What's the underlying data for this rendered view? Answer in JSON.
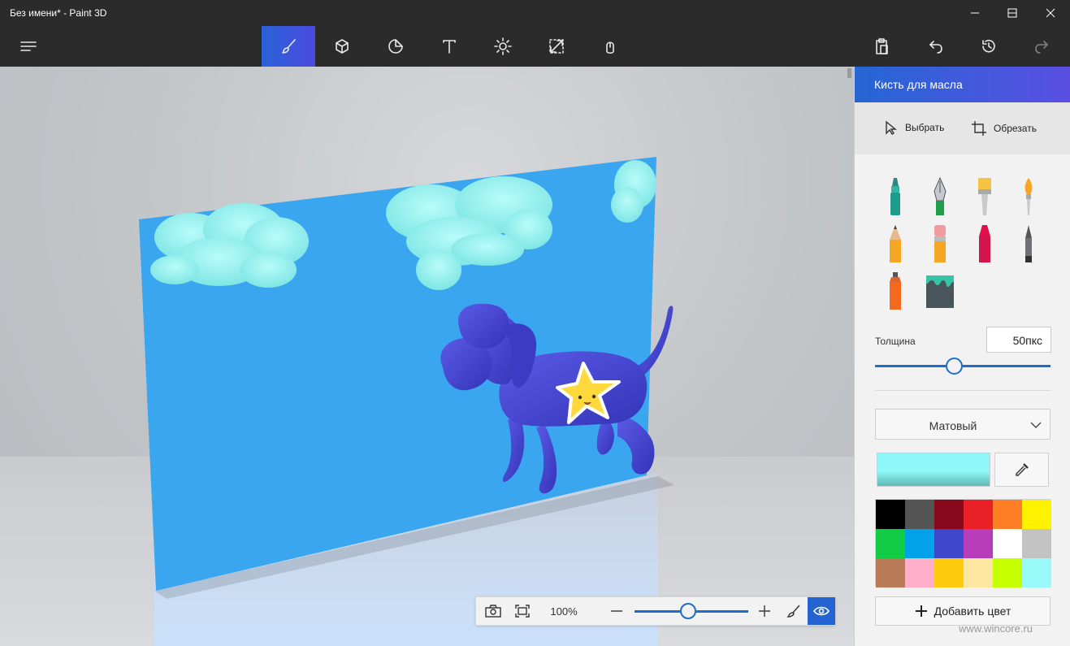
{
  "window": {
    "title": "Без имени* - Paint 3D"
  },
  "toolbar": {
    "tools": [
      {
        "name": "brushes",
        "active": true
      },
      {
        "name": "3d-shapes",
        "active": false
      },
      {
        "name": "stickers",
        "active": false
      },
      {
        "name": "text",
        "active": false
      },
      {
        "name": "effects",
        "active": false
      },
      {
        "name": "canvas",
        "active": false
      },
      {
        "name": "remix3d",
        "active": false
      }
    ],
    "right": [
      "paste",
      "undo",
      "history",
      "redo"
    ]
  },
  "panel": {
    "title": "Кисть для масла",
    "select_label": "Выбрать",
    "crop_label": "Обрезать",
    "brushes": [
      "marker",
      "calligraphy-pen",
      "oil-brush",
      "watercolor",
      "pencil",
      "eraser",
      "crayon",
      "pixel-pen",
      "spray-can",
      "fill"
    ],
    "thickness_label": "Толщина",
    "thickness_value": "50пкс",
    "thickness_fraction": 0.45,
    "finish": "Матовый",
    "current_color": "#8ff7f7",
    "palette": [
      "#000000",
      "#555555",
      "#8a0a1d",
      "#ea2027",
      "#ff7f27",
      "#fff200",
      "#12cc45",
      "#00a2e8",
      "#3f48cc",
      "#b83dba",
      "#ffffff",
      "#c3c3c3",
      "#b97a57",
      "#ffaec9",
      "#ffc90e",
      "#fce6a0",
      "#c6ff00",
      "#99f9f9"
    ],
    "add_color_label": "Добавить цвет"
  },
  "viewbar": {
    "zoom": "100%",
    "zoom_fraction": 0.47
  },
  "watermark": "www.wincore.ru"
}
